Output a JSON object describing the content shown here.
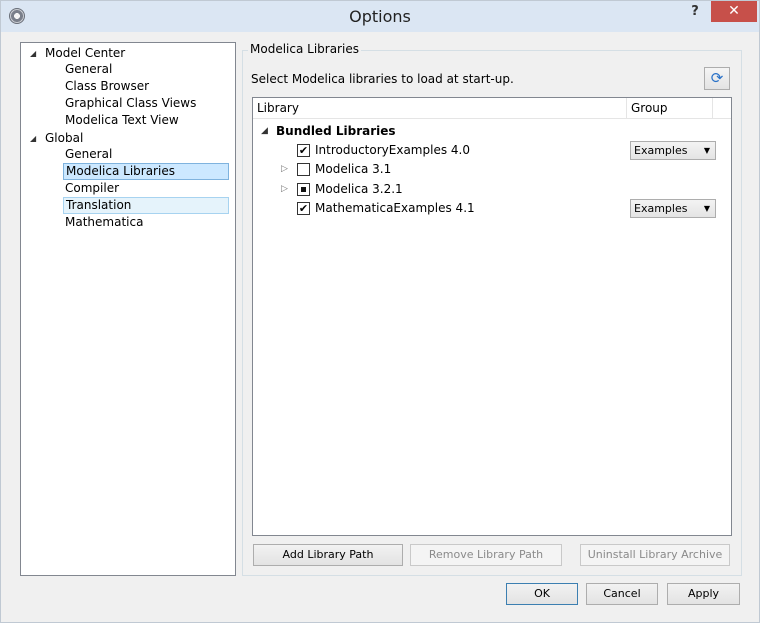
{
  "window": {
    "title": "Options",
    "help": "?",
    "close": "✕"
  },
  "tree": {
    "groups": [
      {
        "label": "Model Center",
        "children": [
          "General",
          "Class Browser",
          "Graphical Class Views",
          "Modelica Text View"
        ]
      },
      {
        "label": "Global",
        "children": [
          "General",
          "Modelica Libraries",
          "Compiler",
          "Translation",
          "Mathematica"
        ]
      }
    ],
    "selected": "Modelica Libraries"
  },
  "panel": {
    "title": "Modelica Libraries",
    "description": "Select Modelica libraries to load at start-up.",
    "refresh_icon": "refresh-icon"
  },
  "table": {
    "headers": [
      "Library",
      "Group"
    ],
    "category": "Bundled Libraries",
    "rows": [
      {
        "name": "IntroductoryExamples 4.0",
        "check": "checked",
        "group": "Examples"
      },
      {
        "name": "Modelica 3.1",
        "check": "unchecked",
        "group": ""
      },
      {
        "name": "Modelica 3.2.1",
        "check": "partial",
        "group": ""
      },
      {
        "name": "MathematicaExamples 4.1",
        "check": "checked",
        "group": "Examples"
      }
    ]
  },
  "buttons": {
    "add_path": "Add Library Path",
    "remove_path": "Remove Library Path",
    "uninstall": "Uninstall Library Archive",
    "ok": "OK",
    "cancel": "Cancel",
    "apply": "Apply"
  }
}
